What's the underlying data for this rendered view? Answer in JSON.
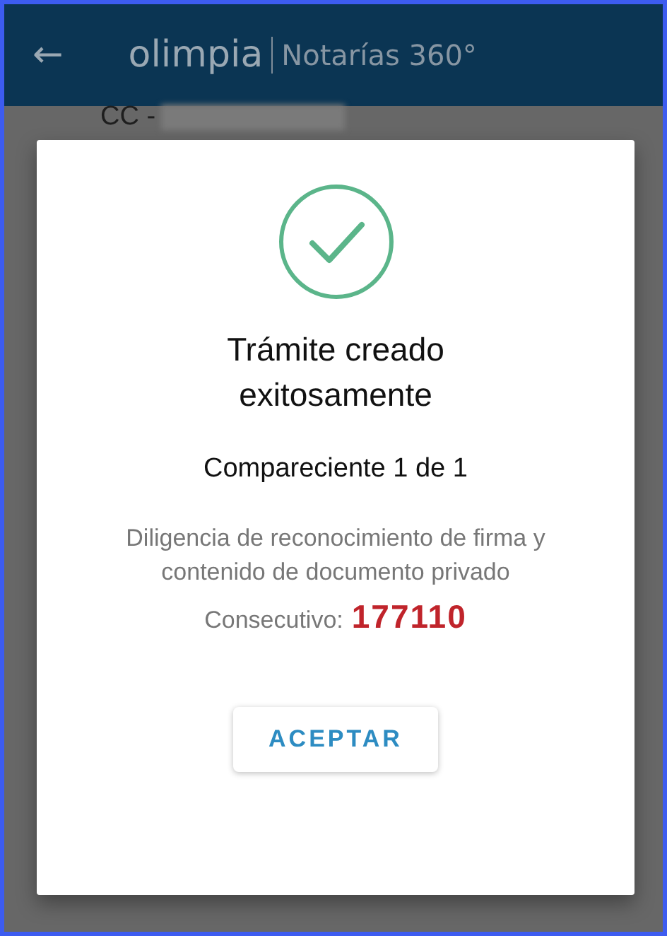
{
  "app_bar": {
    "back": "←",
    "logo": "olimpia",
    "subtitle": "Notarías 360°"
  },
  "background": {
    "id_label": "CC -"
  },
  "dialog": {
    "success": true,
    "title": "Trámite creado exitosamente",
    "subtitle": "Compareciente 1 de 1",
    "description": "Diligencia de reconocimiento de firma y contenido de documento privado",
    "number_label": "Consecutivo:",
    "number": "177110",
    "button": "ACEPTAR"
  }
}
